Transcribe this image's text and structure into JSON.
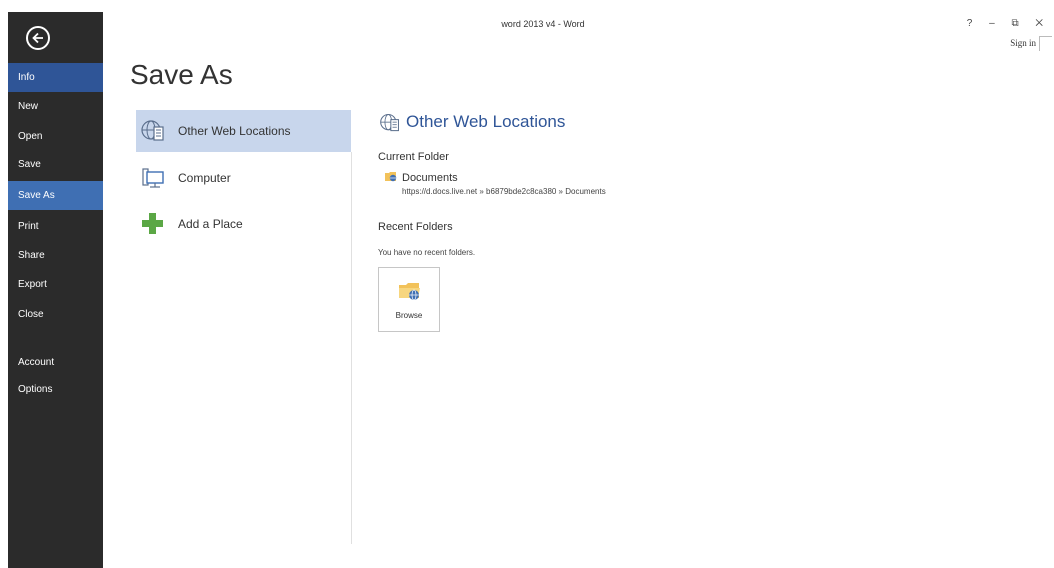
{
  "window": {
    "title": "word 2013 v4 - Word",
    "controls": "? – ⧉ ✕",
    "sign_in": "Sign in"
  },
  "sidebar": {
    "items": [
      {
        "label": "Info"
      },
      {
        "label": "New"
      },
      {
        "label": "Open"
      },
      {
        "label": "Save"
      },
      {
        "label": "Save As"
      },
      {
        "label": "Print"
      },
      {
        "label": "Share"
      },
      {
        "label": "Export"
      },
      {
        "label": "Close"
      },
      {
        "label": "Account"
      },
      {
        "label": "Options"
      }
    ],
    "selected": "Save As",
    "highlighted": "Info"
  },
  "page": {
    "title": "Save As"
  },
  "locations": [
    {
      "label": "Other Web Locations",
      "icon": "globe-server-icon",
      "active": true
    },
    {
      "label": "Computer",
      "icon": "computer-icon",
      "active": false
    },
    {
      "label": "Add a Place",
      "icon": "add-plus-icon",
      "active": false
    }
  ],
  "detail": {
    "title": "Other Web Locations",
    "current_folder_heading": "Current Folder",
    "current_folder": {
      "name": "Documents",
      "path": "https://d.docs.live.net » b6879bde2c8ca380 » Documents"
    },
    "recent_heading": "Recent Folders",
    "no_recent": "You have no recent folders.",
    "browse_label": "Browse"
  },
  "colors": {
    "sidebar_bg": "#2b2b2b",
    "nav_active": "#2f5597",
    "nav_selected": "#3f6fb3",
    "location_active": "#c8d6ec",
    "accent_blue": "#2f5597",
    "add_green": "#5ba745"
  }
}
